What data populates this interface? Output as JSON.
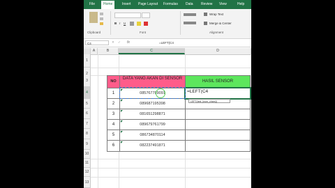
{
  "ribbon_tabs": [
    "File",
    "Home",
    "Insert",
    "Page Layout",
    "Formulas",
    "Data",
    "Review",
    "View",
    "Help"
  ],
  "active_tab": "Home",
  "ribbon_groups": {
    "clipboard": "Clipboard",
    "font": "Font",
    "alignment": "Alignment",
    "wrap_text": "Wrap Text",
    "merge_center": "Merge & Center"
  },
  "formula_bar": {
    "name_box": "C4",
    "fx": "fx",
    "content": "=LEFT(C4"
  },
  "columns": [
    "A",
    "B",
    "C",
    "D"
  ],
  "rows": [
    "1",
    "2",
    "3",
    "4",
    "5",
    "6",
    "7",
    "8",
    "9",
    "10",
    "11",
    "12",
    "13"
  ],
  "table": {
    "header_no": "NO",
    "header_data": "DATA YANG AKAN DI SENSOR",
    "header_result": "HASIL SENSOR",
    "data": [
      {
        "no": "1",
        "phone": "085767789091",
        "result": "=LEFT(C4"
      },
      {
        "no": "2",
        "phone": "089687195398",
        "result": ""
      },
      {
        "no": "3",
        "phone": "081651298871",
        "result": ""
      },
      {
        "no": "4",
        "phone": "089679761799",
        "result": ""
      },
      {
        "no": "5",
        "phone": "086734870114",
        "result": ""
      },
      {
        "no": "6",
        "phone": "082237491871",
        "result": ""
      }
    ]
  },
  "tooltip": "LEFT(text, [num_chars])",
  "colors": {
    "excel_green": "#217346",
    "header_pink": "#ff5c8a",
    "header_green": "#5de65d"
  }
}
